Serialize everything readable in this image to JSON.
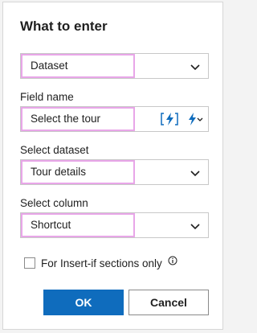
{
  "dialog": {
    "title": "What to enter"
  },
  "what_to_enter": {
    "value": "Dataset"
  },
  "field_name": {
    "label": "Field name",
    "value": "Select the tour"
  },
  "select_dataset": {
    "label": "Select dataset",
    "value": "Tour details"
  },
  "select_column": {
    "label": "Select column",
    "value": "Shortcut"
  },
  "insert_if": {
    "label": "For Insert-if sections only",
    "checked": false
  },
  "buttons": {
    "ok": "OK",
    "cancel": "Cancel"
  },
  "colors": {
    "accent": "#0f6cbd",
    "highlight": "#e8a6e8"
  },
  "icons": {
    "dropdown": "chevron-down-icon",
    "field_action": "bracket-lightning-icon",
    "field_menu": "lightning-dropdown-icon",
    "info": "info-icon"
  }
}
